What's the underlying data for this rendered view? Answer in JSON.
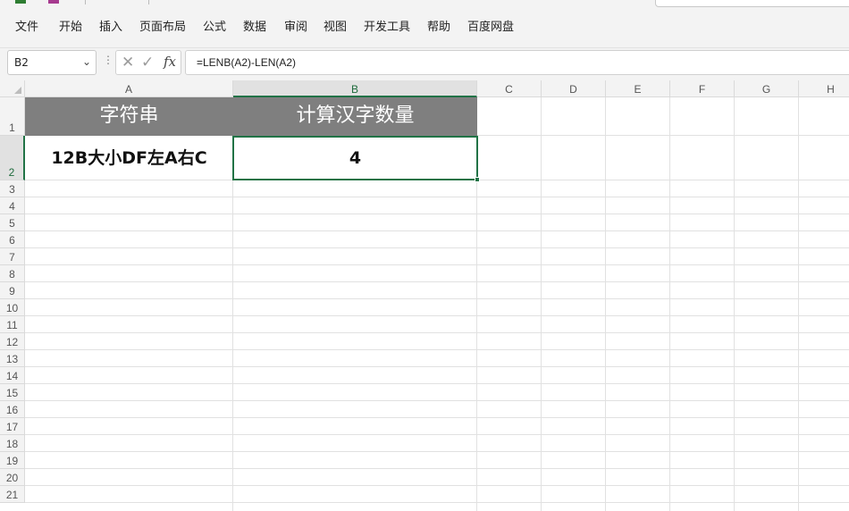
{
  "menu": {
    "items": [
      "文件",
      "开始",
      "插入",
      "页面布局",
      "公式",
      "数据",
      "审阅",
      "视图",
      "开发工具",
      "帮助",
      "百度网盘"
    ]
  },
  "formula_bar": {
    "name_box": "B2",
    "formula": "=LENB(A2)-LEN(A2)",
    "cancel_icon": "cancel-x-icon",
    "enter_icon": "checkmark-icon",
    "function_icon": "fx-icon"
  },
  "sheet": {
    "column_headers": [
      "A",
      "B",
      "C",
      "D",
      "E",
      "F",
      "G",
      "H"
    ],
    "row_numbers": [
      "1",
      "2",
      "3",
      "4",
      "5",
      "6",
      "7",
      "8",
      "9",
      "10",
      "11",
      "12",
      "13",
      "14",
      "15",
      "16",
      "17",
      "18",
      "19",
      "20",
      "21"
    ],
    "selected_cell": "B2",
    "cells": {
      "A1": "字符串",
      "B1": "计算汉字数量",
      "A2": "12B大小DF左A右C",
      "B2": "4"
    },
    "header_fill_color": "#7f7f7f",
    "selection_color": "#217346"
  }
}
